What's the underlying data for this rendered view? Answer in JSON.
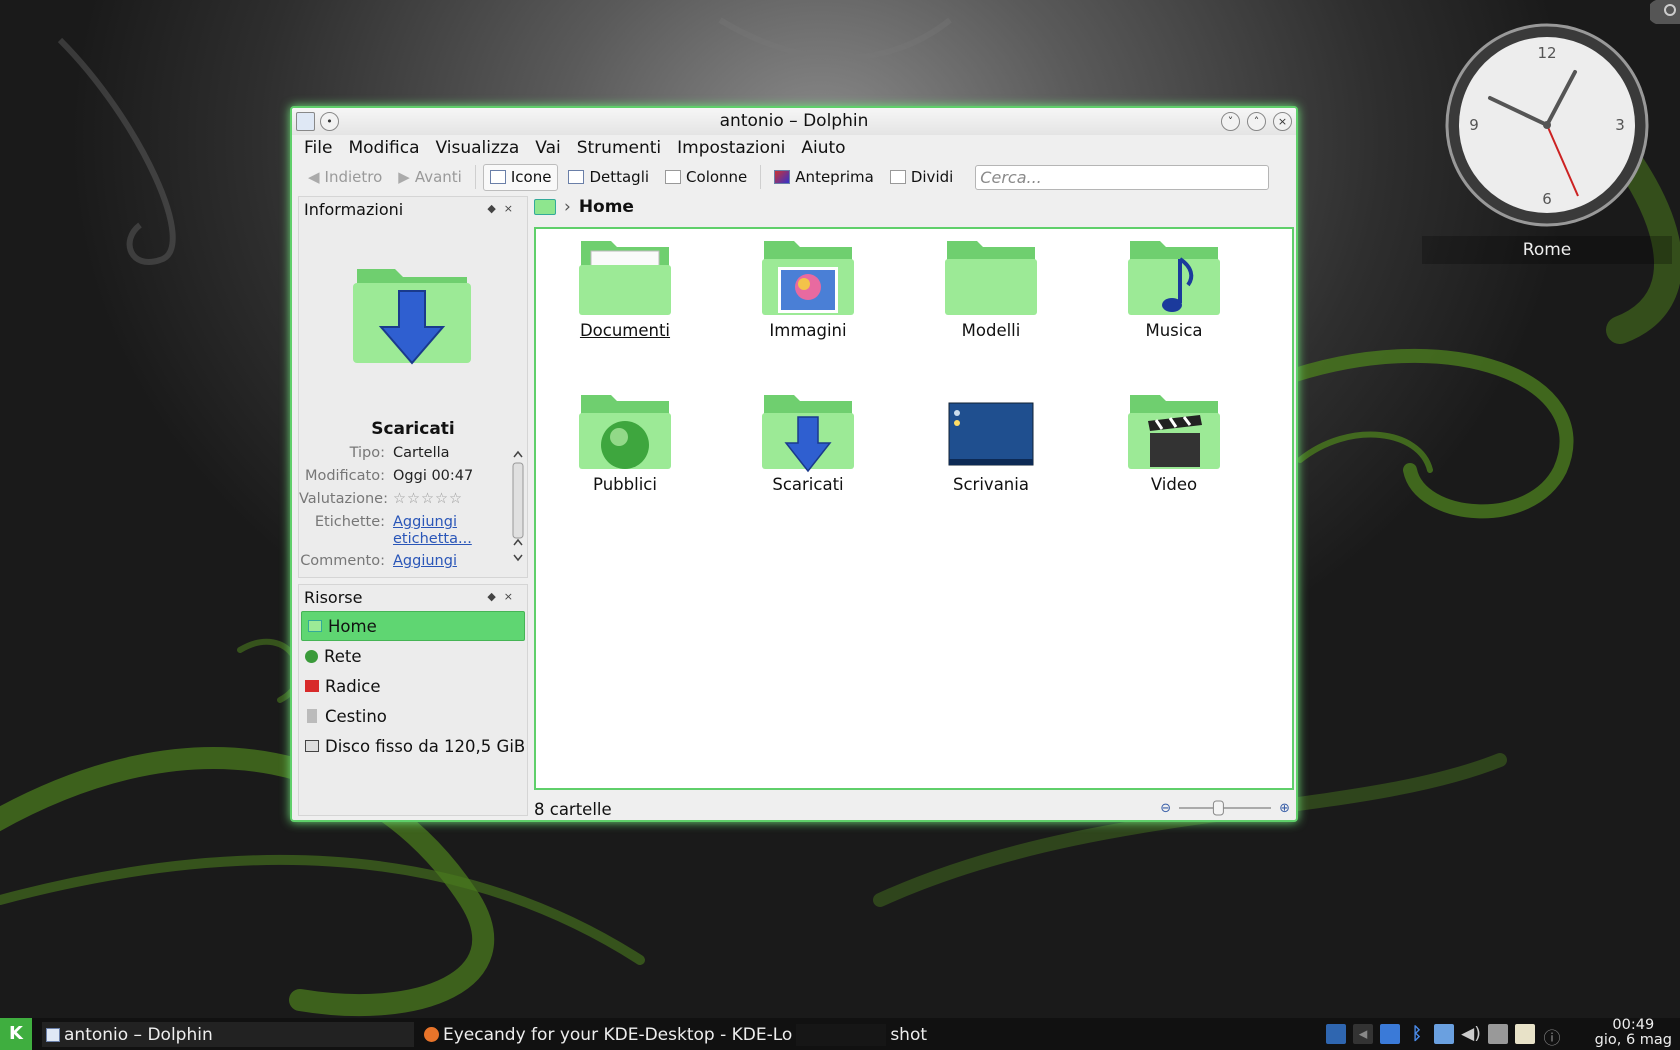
{
  "window": {
    "title": "antonio – Dolphin"
  },
  "menu": [
    "File",
    "Modifica",
    "Visualizza",
    "Vai",
    "Strumenti",
    "Impostazioni",
    "Aiuto"
  ],
  "toolbar": {
    "back": "Indietro",
    "forward": "Avanti",
    "icons": "Icone",
    "details": "Dettagli",
    "columns": "Colonne",
    "preview": "Anteprima",
    "split": "Dividi",
    "search_placeholder": "Cerca..."
  },
  "info_panel": {
    "title": "Informazioni",
    "name": "Scaricati",
    "type_label": "Tipo:",
    "type_value": "Cartella",
    "modified_label": "Modificato:",
    "modified_value": "Oggi 00:47",
    "rating_label": "Valutazione:",
    "rating": 0,
    "tags_label": "Etichette:",
    "tags_link_1": "Aggiungi",
    "tags_link_2": "etichetta...",
    "comment_label": "Commento:",
    "comment_link": "Aggiungi"
  },
  "places_panel": {
    "title": "Risorse",
    "items": [
      "Home",
      "Rete",
      "Radice",
      "Cestino",
      "Disco fisso da 120,5 GiB"
    ]
  },
  "breadcrumb": {
    "current": "Home"
  },
  "folders": [
    "Documenti",
    "Immagini",
    "Modelli",
    "Musica",
    "Pubblici",
    "Scaricati",
    "Scrivania",
    "Video"
  ],
  "status": {
    "text": "8 cartelle",
    "zoom": 0.42
  },
  "clock": {
    "city": "Rome",
    "numbers": [
      "12",
      "3",
      "6",
      "9"
    ]
  },
  "taskbar": {
    "task1": "antonio – Dolphin",
    "task2": "Eyecandy for your KDE-Desktop - KDE-Lo",
    "task2_tail": "shot",
    "time": "00:49",
    "date": "gio, 6 mag"
  },
  "colors": {
    "accent": "#5fd672",
    "folder": "#8ee68e",
    "link": "#2a56b8"
  }
}
